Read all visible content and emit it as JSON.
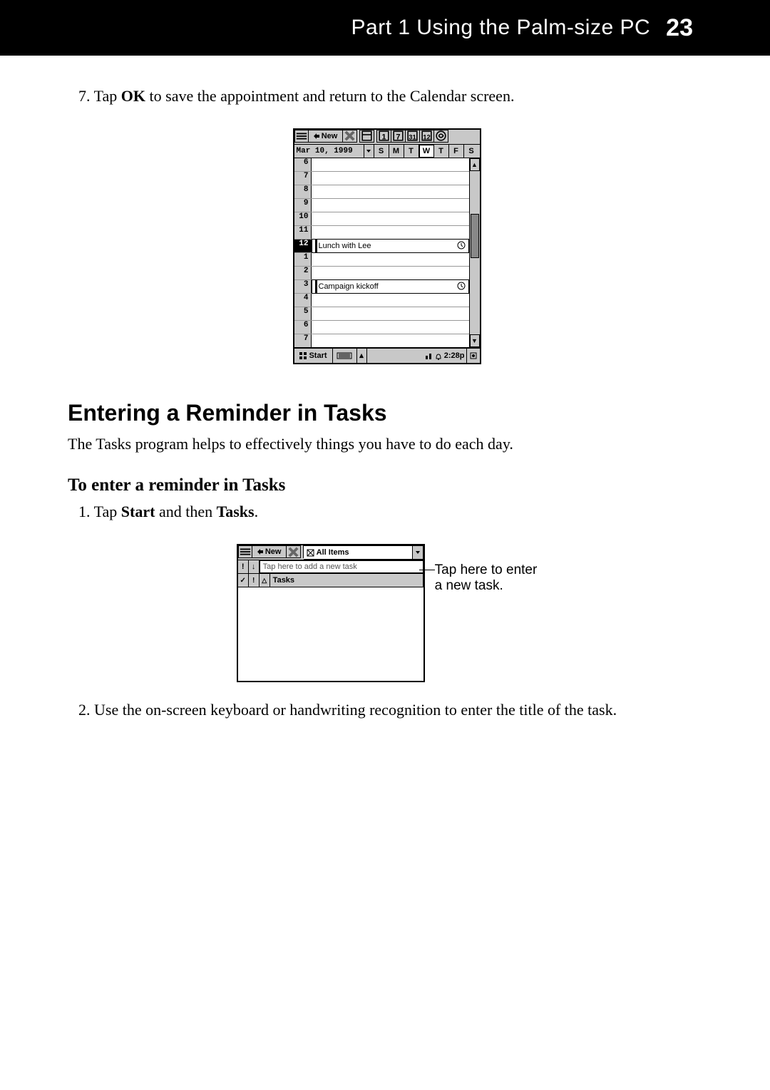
{
  "header": {
    "part_label": "Part 1  Using the Palm-size PC",
    "page_number": "23"
  },
  "step7": {
    "num": "7.",
    "pre": " Tap ",
    "bold": "OK",
    "post": " to save the appointment and return to the Calendar screen."
  },
  "calendar_shot": {
    "toolbar": {
      "new_label": "New"
    },
    "date": "Mar 10, 1999",
    "days": [
      "S",
      "M",
      "T",
      "W",
      "T",
      "F",
      "S"
    ],
    "selected_day_index": 3,
    "hours": [
      "6",
      "7",
      "8",
      "9",
      "10",
      "11",
      "12",
      "1",
      "2",
      "3",
      "4",
      "5",
      "6",
      "7"
    ],
    "selected_hour_index": 6,
    "appointments": {
      "12": "Lunch with Lee",
      "3": "Campaign kickoff"
    },
    "taskbar": {
      "start": "Start",
      "clock": "2:28p"
    }
  },
  "section_heading": "Entering a Reminder in Tasks",
  "section_intro": "The Tasks program helps to effectively things you have to do each day.",
  "subheading": "To enter a reminder in Tasks",
  "step1": {
    "num": "1.",
    "pre": " Tap ",
    "b1": "Start",
    "mid": " and then ",
    "b2": "Tasks",
    "post": "."
  },
  "tasks_shot": {
    "toolbar": {
      "new_label": "New"
    },
    "filter_label": "All Items",
    "placeholder": "Tap here to add a new task",
    "column_header": "Tasks"
  },
  "callout": {
    "l1": "Tap here to enter",
    "l2": "a new task."
  },
  "step2": {
    "num": "2.",
    "text": " Use the on-screen keyboard or handwriting recognition to enter the title of the task."
  }
}
